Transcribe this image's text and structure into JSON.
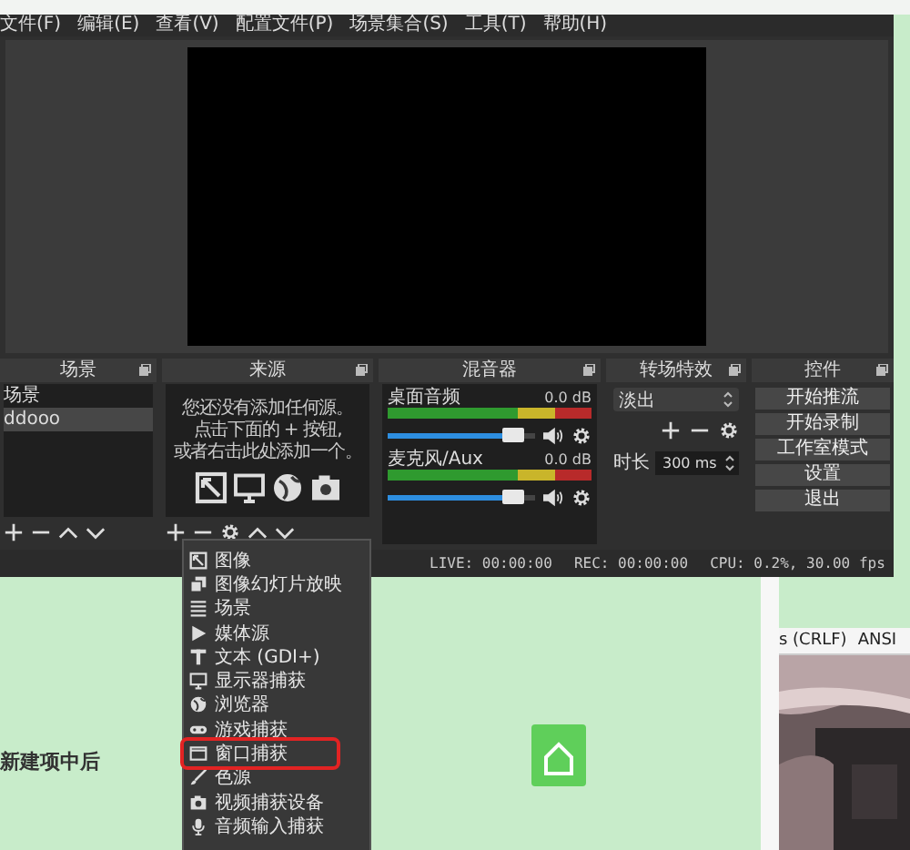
{
  "menu_bar": [
    {
      "label": "文件(F)"
    },
    {
      "label": "编辑(E)"
    },
    {
      "label": "查看(V)"
    },
    {
      "label": "配置文件(P)"
    },
    {
      "label": "场景集合(S)"
    },
    {
      "label": "工具(T)"
    },
    {
      "label": "帮助(H)"
    }
  ],
  "scenes": {
    "title": "场景",
    "items": [
      {
        "label": "场景",
        "selected": false
      },
      {
        "label": "ddooo",
        "selected": true
      }
    ]
  },
  "sources": {
    "title": "来源",
    "empty_hint": [
      "您还没有添加任何源。",
      "点击下面的 + 按钮,",
      "或者右击此处添加一个。"
    ]
  },
  "mixer": {
    "title": "混音器",
    "channels": [
      {
        "name": "桌面音频",
        "reading": "0.0 dB"
      },
      {
        "name": "麦克风/Aux",
        "reading": "0.0 dB"
      }
    ]
  },
  "transitions": {
    "title": "转场特效",
    "current": "淡出",
    "duration_label": "时长",
    "duration": "300 ms"
  },
  "controls": {
    "title": "控件",
    "buttons": [
      "开始推流",
      "开始录制",
      "工作室模式",
      "设置",
      "退出"
    ]
  },
  "status_bar": {
    "live": "LIVE: 00:00:00",
    "rec": "REC: 00:00:00",
    "cpu": "CPU: 0.2%, 30.00 fps"
  },
  "add_source_menu": [
    {
      "label": "图像",
      "selected": false
    },
    {
      "label": "图像幻灯片放映",
      "selected": false
    },
    {
      "label": "场景",
      "selected": false
    },
    {
      "label": "媒体源",
      "selected": false
    },
    {
      "label": "文本 (GDI+)",
      "selected": false
    },
    {
      "label": "显示器捕获",
      "selected": false
    },
    {
      "label": "浏览器",
      "selected": false
    },
    {
      "label": "游戏捕获",
      "selected": false
    },
    {
      "label": "窗口捕获",
      "selected": true
    },
    {
      "label": "色源",
      "selected": false
    },
    {
      "label": "视频捕获设备",
      "selected": false
    },
    {
      "label": "音频输入捕获",
      "selected": false
    }
  ],
  "desktop": {
    "editor_status": [
      "s (CRLF)",
      "ANSI"
    ],
    "caption": "新建项中后"
  }
}
